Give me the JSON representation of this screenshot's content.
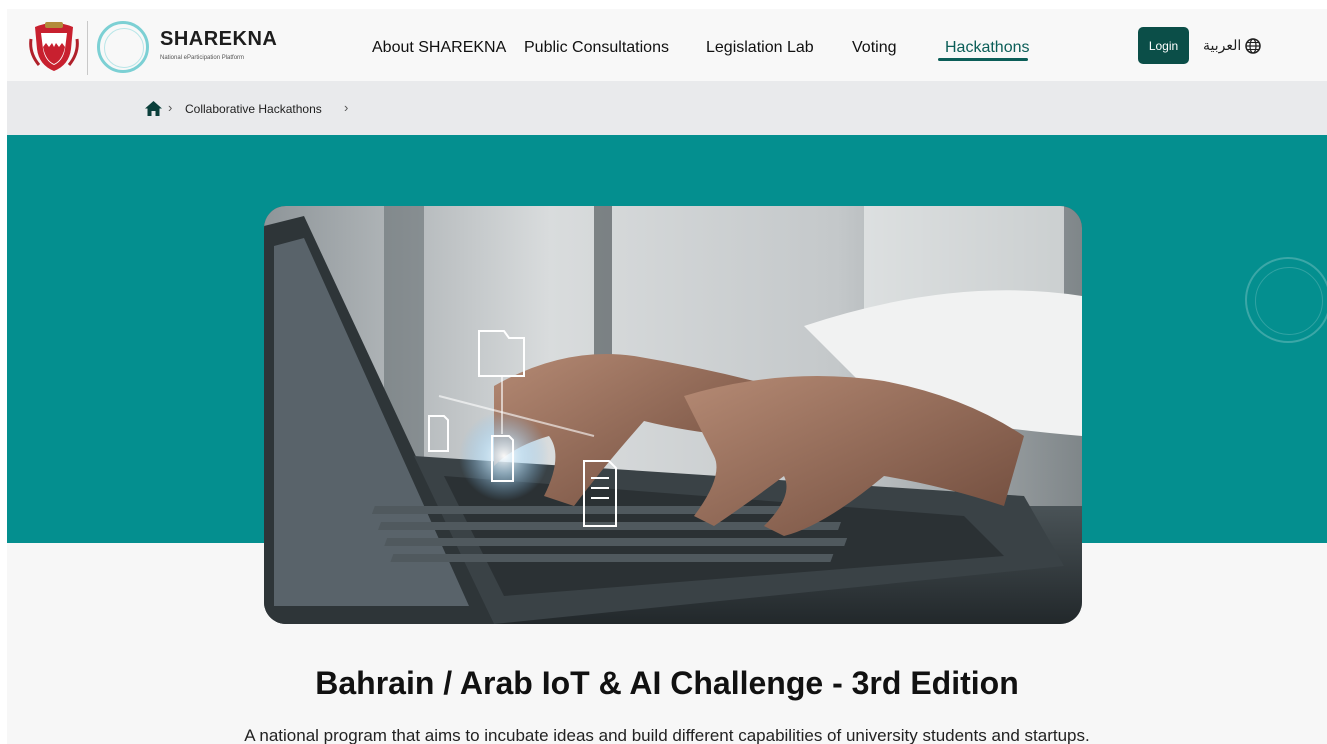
{
  "header": {
    "brand_name": "SHAREKNA",
    "brand_subtitle": "National eParticipation Platform",
    "nav": [
      {
        "label": "About SHAREKNA"
      },
      {
        "label": "Public Consultations"
      },
      {
        "label": "Legislation Lab"
      },
      {
        "label": "Voting"
      },
      {
        "label": "Hackathons",
        "active": true
      }
    ],
    "login_label": "Login",
    "language_label": "العربية",
    "icons": {
      "emblem": "bahrain-emblem-icon",
      "logo": "sharekna-ring-logo-icon",
      "language": "globe-icon"
    }
  },
  "breadcrumb": {
    "home_icon": "home-icon",
    "items": [
      {
        "label": "Collaborative Hackathons"
      }
    ]
  },
  "hero": {
    "image_description_icon": "laptop-typing-hero-image",
    "title": "Bahrain / Arab IoT & AI Challenge - 3rd Edition",
    "description": "A national program that aims to incubate ideas and build different capabilities of university students and startups."
  },
  "colors": {
    "brand_dark": "#0b4e48",
    "hero_band": "#048f8f",
    "active_nav": "#0b5e58"
  }
}
